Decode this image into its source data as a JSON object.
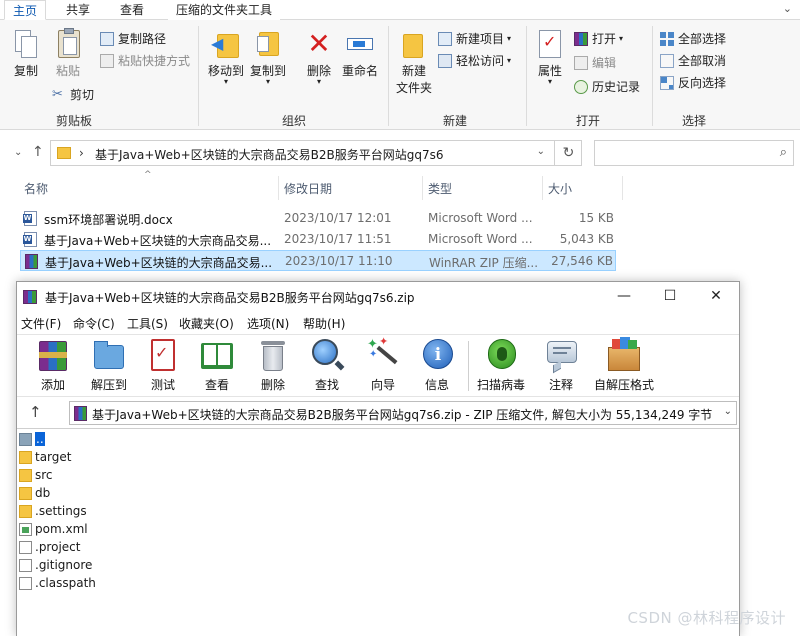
{
  "explorer": {
    "tabs": [
      {
        "label": "主页",
        "active": true
      },
      {
        "label": "共享",
        "active": false
      },
      {
        "label": "查看",
        "active": false
      },
      {
        "label": "压缩的文件夹工具",
        "active": false
      }
    ],
    "ribbon": {
      "clipboard": {
        "copy": "复制",
        "paste": "粘贴",
        "copy_path": "复制路径",
        "paste_shortcut": "粘贴快捷方式",
        "cut": "剪切",
        "group": "剪贴板"
      },
      "organize": {
        "move_to": "移动到",
        "copy_to": "复制到",
        "delete": "删除",
        "rename": "重命名",
        "group": "组织"
      },
      "new": {
        "new_folder_l1": "新建",
        "new_folder_l2": "文件夹",
        "new_item": "新建项目",
        "easy_access": "轻松访问",
        "group": "新建"
      },
      "open": {
        "properties": "属性",
        "open": "打开",
        "edit": "编辑",
        "history": "历史记录",
        "group": "打开"
      },
      "select": {
        "select_all": "全部选择",
        "select_none": "全部取消",
        "invert": "反向选择",
        "group": "选择"
      }
    },
    "address": {
      "path": "基于Java+Web+区块链的大宗商品交易B2B服务平台网站gq7s6"
    },
    "columns": {
      "name": "名称",
      "date": "修改日期",
      "type": "类型",
      "size": "大小"
    },
    "files": [
      {
        "name": "ssm环境部署说明.docx",
        "date": "2023/10/17 12:01",
        "type": "Microsoft Word ...",
        "size": "15 KB",
        "icon": "word-icon",
        "selected": false
      },
      {
        "name": "基于Java+Web+区块链的大宗商品交易...",
        "date": "2023/10/17 11:51",
        "type": "Microsoft Word ...",
        "size": "5,043 KB",
        "icon": "word-icon",
        "selected": false
      },
      {
        "name": "基于Java+Web+区块链的大宗商品交易...",
        "date": "2023/10/17 11:10",
        "type": "WinRAR ZIP 压缩...",
        "size": "27,546 KB",
        "icon": "winrar-icon",
        "selected": true
      }
    ]
  },
  "winrar": {
    "title": "基于Java+Web+区块链的大宗商品交易B2B服务平台网站gq7s6.zip",
    "menu": [
      "文件(F)",
      "命令(C)",
      "工具(S)",
      "收藏夹(O)",
      "选项(N)",
      "帮助(H)"
    ],
    "tools": [
      {
        "label": "添加",
        "icon": "add-archive-icon"
      },
      {
        "label": "解压到",
        "icon": "extract-to-icon"
      },
      {
        "label": "测试",
        "icon": "test-icon"
      },
      {
        "label": "查看",
        "icon": "view-book-icon"
      },
      {
        "label": "删除",
        "icon": "trash-icon"
      },
      {
        "label": "查找",
        "icon": "find-magnifier-icon"
      },
      {
        "label": "向导",
        "icon": "wizard-wand-icon"
      },
      {
        "label": "信息",
        "icon": "info-icon"
      },
      {
        "label": "扫描病毒",
        "icon": "virus-scan-icon"
      },
      {
        "label": "注释",
        "icon": "comment-icon"
      },
      {
        "label": "自解压格式",
        "icon": "sfx-box-icon"
      }
    ],
    "address": "基于Java+Web+区块链的大宗商品交易B2B服务平台网站gq7s6.zip - ZIP 压缩文件, 解包大小为 55,134,249 字节",
    "items": [
      {
        "name": "..",
        "kind": "up"
      },
      {
        "name": "target",
        "kind": "folder"
      },
      {
        "name": "src",
        "kind": "folder"
      },
      {
        "name": "db",
        "kind": "folder"
      },
      {
        "name": ".settings",
        "kind": "folder"
      },
      {
        "name": "pom.xml",
        "kind": "xml"
      },
      {
        "name": ".project",
        "kind": "file"
      },
      {
        "name": ".gitignore",
        "kind": "file"
      },
      {
        "name": ".classpath",
        "kind": "file"
      }
    ]
  },
  "watermark": "CSDN @林科程序设计",
  "colors": {
    "selection": "#cce8ff",
    "accent": "#0b57b0",
    "folder": "#f5c542"
  }
}
